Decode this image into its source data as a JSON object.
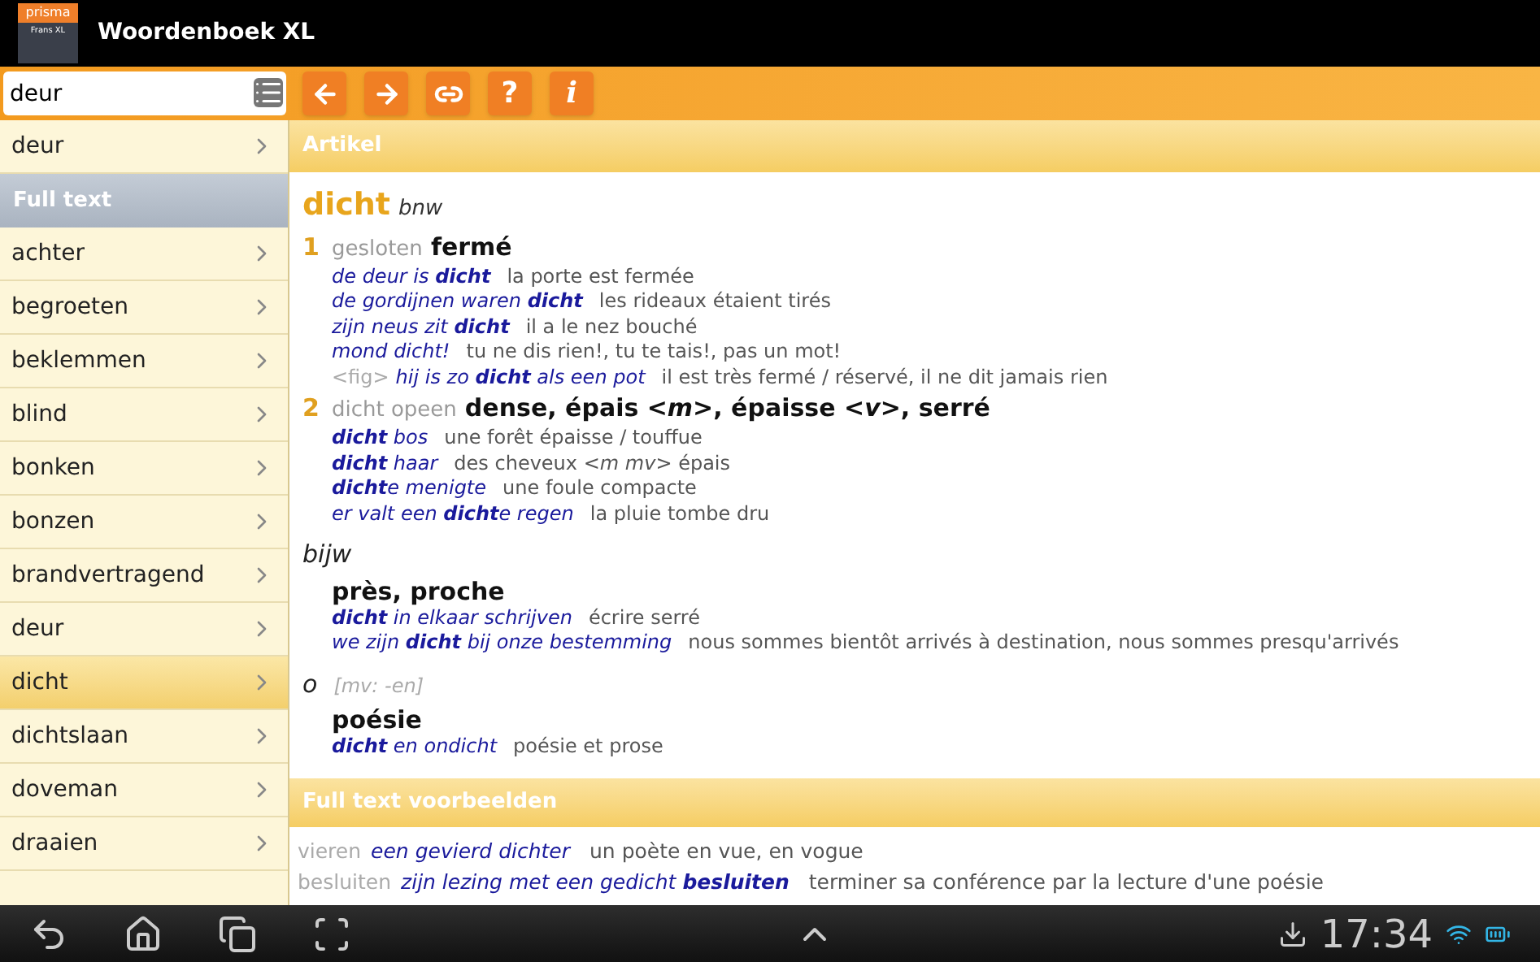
{
  "app_bar": {
    "title": "Woordenboek XL",
    "logo_text": "prisma",
    "logo_subtext": "Frans XL"
  },
  "search": {
    "value": "deur"
  },
  "toolbar_buttons": [
    {
      "kind": "back"
    },
    {
      "kind": "forward"
    },
    {
      "kind": "link"
    },
    {
      "kind": "help",
      "label": "?"
    },
    {
      "kind": "info",
      "label": "i"
    }
  ],
  "sidebar": {
    "results": [
      {
        "label": "deur",
        "selected": false
      }
    ],
    "section_title": "Full text",
    "items": [
      {
        "label": "achter",
        "selected": false
      },
      {
        "label": "begroeten",
        "selected": false
      },
      {
        "label": "beklemmen",
        "selected": false
      },
      {
        "label": "blind",
        "selected": false
      },
      {
        "label": "bonken",
        "selected": false
      },
      {
        "label": "bonzen",
        "selected": false
      },
      {
        "label": "brandvertragend",
        "selected": false
      },
      {
        "label": "deur",
        "selected": false
      },
      {
        "label": "dicht",
        "selected": true
      },
      {
        "label": "dichtslaan",
        "selected": false
      },
      {
        "label": "doveman",
        "selected": false
      },
      {
        "label": "draaien",
        "selected": false
      }
    ]
  },
  "article": {
    "title": "Artikel",
    "headword": "dicht",
    "pos": "bnw",
    "senses": [
      {
        "number": "1",
        "gloss": "gesloten",
        "translation": "fermé",
        "examples": [
          {
            "nl": "de deur is **dicht**",
            "fr": "la porte est fermée"
          },
          {
            "nl": "de gordijnen waren **dicht**",
            "fr": "les rideaux étaient tirés"
          },
          {
            "nl": "zijn neus zit **dicht**",
            "fr": "il a le nez bouché"
          },
          {
            "nl": "mond dicht!",
            "fr": "tu ne dis rien!, tu te tais!, pas un mot!"
          },
          {
            "note": "<fig>",
            "nl": "hij is zo **dicht** als een pot",
            "fr": "il est très fermé / réservé, il ne dit jamais rien"
          }
        ]
      },
      {
        "number": "2",
        "gloss": "dicht opeen",
        "translation": "dense, épais *<m>*, épaisse *<v>*, serré",
        "examples": [
          {
            "nl": "**dicht** bos",
            "fr": "une forêt épaisse / touffue"
          },
          {
            "nl": "**dicht** haar",
            "fr": "des cheveux *<m mv>* épais"
          },
          {
            "nl": "**dicht**e menigte",
            "fr": "une foule compacte"
          },
          {
            "nl": "er valt een **dicht**e regen",
            "fr": "la pluie tombe dru"
          }
        ]
      }
    ],
    "sections": [
      {
        "pos": "bijw",
        "senses": [
          {
            "translation": "près, proche",
            "examples": [
              {
                "nl": "**dicht** in elkaar schrijven",
                "fr": "écrire serré"
              },
              {
                "nl": "we zijn **dicht** bij onze bestemming",
                "fr": "nous sommes bientôt arrivés à destination, nous sommes presqu'arrivés"
              }
            ]
          }
        ]
      },
      {
        "pos": "o",
        "note": "[mv: -en]",
        "senses": [
          {
            "translation": "poésie",
            "examples": [
              {
                "nl": "**dicht** en ondicht",
                "fr": "poésie et prose"
              }
            ]
          }
        ]
      }
    ]
  },
  "full_text_examples": {
    "title": "Full text voorbeelden",
    "rows": [
      {
        "head": "vieren",
        "nl": "een gevierd *dichter*",
        "fr": "un poète en vue, en vogue"
      },
      {
        "head": "besluiten",
        "nl": "zijn lezing met een *gedicht* **besluiten**",
        "fr": "terminer sa conférence par la lecture d'une poésie"
      }
    ]
  },
  "status_bar": {
    "time": "17:34"
  }
}
